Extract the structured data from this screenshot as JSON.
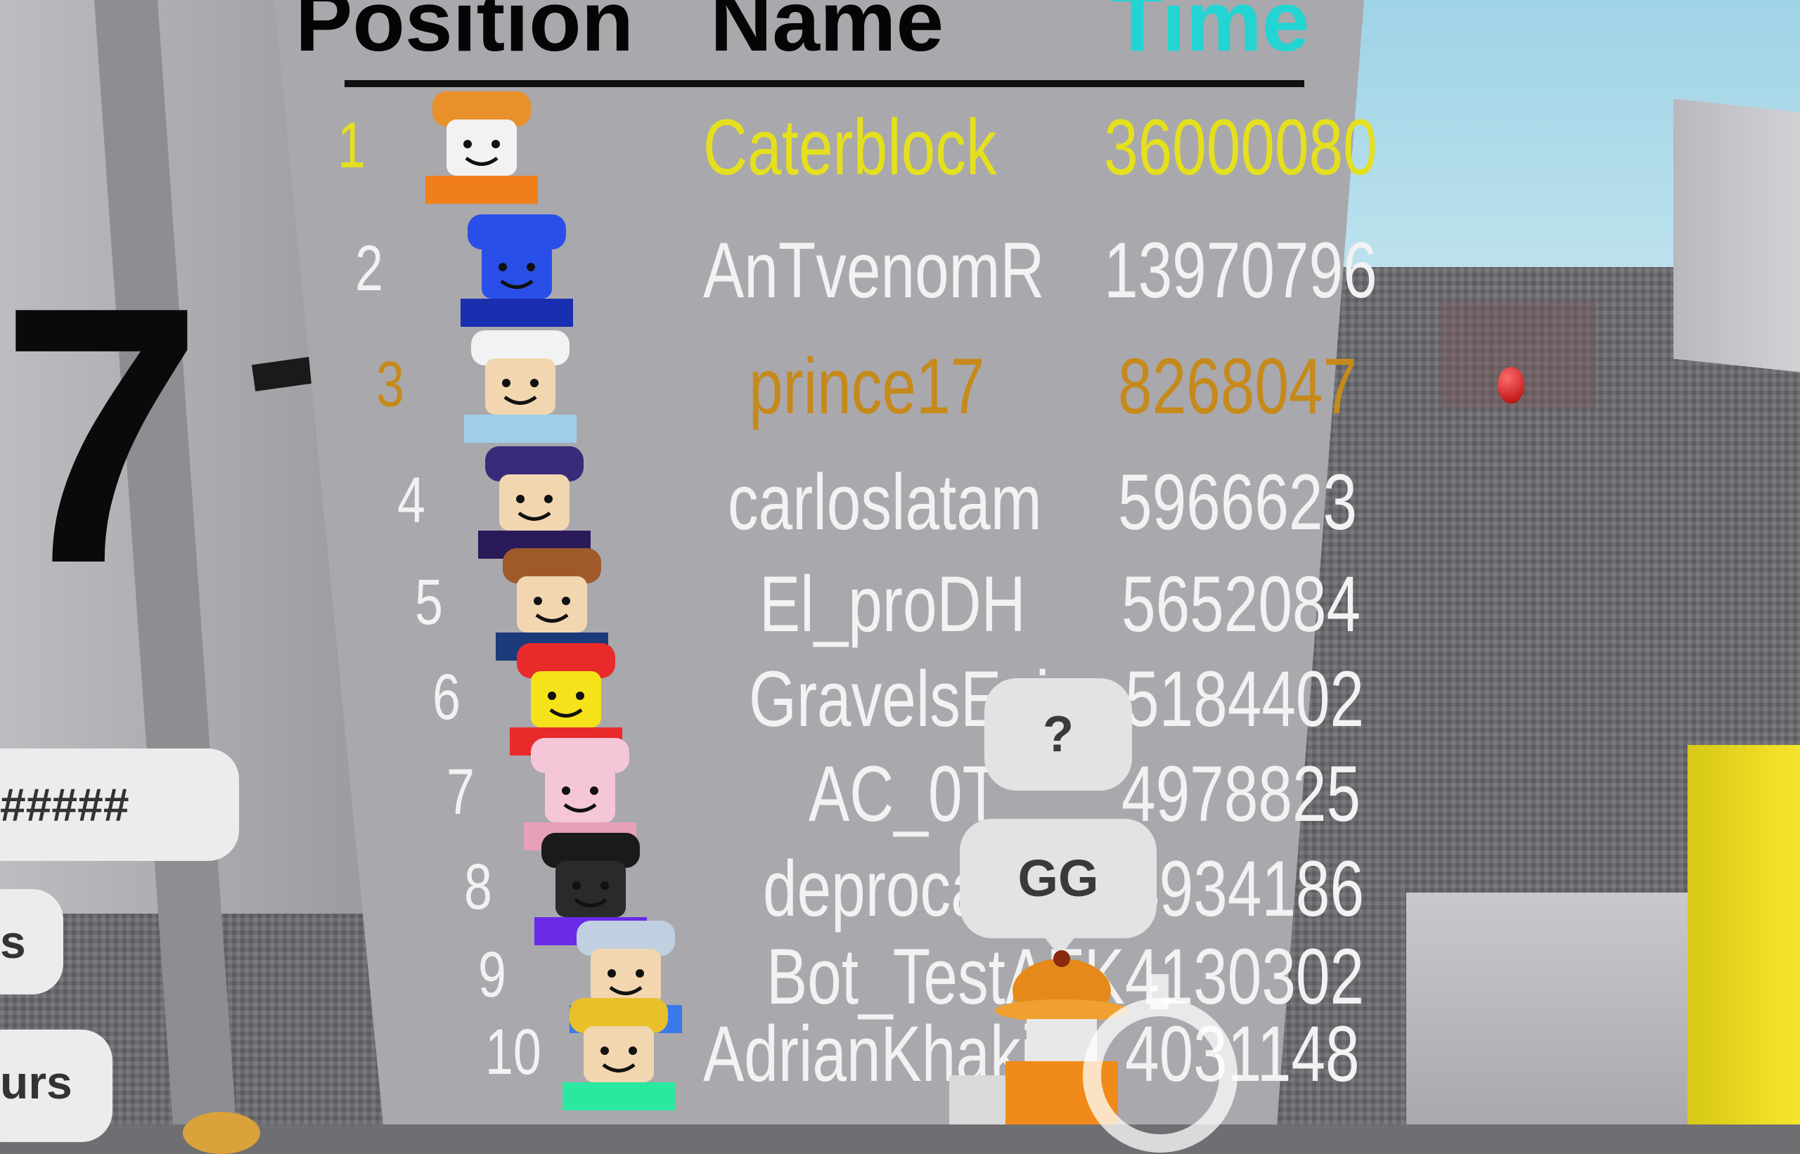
{
  "scene": {
    "sign_number": "7",
    "side_buttons": [
      "#####",
      "s",
      "urs"
    ]
  },
  "leaderboard": {
    "headers": {
      "position": "Position",
      "name": "Name",
      "time": "Time"
    },
    "colors": {
      "gold": "#e5e01d",
      "bronze": "#c58a1b",
      "default": "#f2f2f2",
      "time_header": "#22d4d2"
    },
    "rows": [
      {
        "position": "1",
        "name": "Caterblock",
        "time": "36000080",
        "rank_color": "gold",
        "avatar": "tiger-hat-avatar-icon"
      },
      {
        "position": "2",
        "name": "AnTvenomR",
        "time": "13970796",
        "rank_color": "default",
        "avatar": "blue-smiley-avatar-icon"
      },
      {
        "position": "3",
        "name": "prince17",
        "time": "8268047",
        "rank_color": "bronze",
        "avatar": "white-hat-avatar-icon"
      },
      {
        "position": "4",
        "name": "carloslatam",
        "time": "5966623",
        "rank_color": "default",
        "avatar": "wizard-hat-avatar-icon"
      },
      {
        "position": "5",
        "name": "El_proDH",
        "time": "5652084",
        "rank_color": "default",
        "avatar": "brown-hair-avatar-icon"
      },
      {
        "position": "6",
        "name": "GravelsEpic",
        "time": "5184402",
        "rank_color": "default",
        "avatar": "yellow-noob-avatar-icon"
      },
      {
        "position": "7",
        "name": "AC_0T",
        "time": "4978825",
        "rank_color": "default",
        "avatar": "bunny-ears-avatar-icon"
      },
      {
        "position": "8",
        "name": "deprocarter",
        "time": "4934186",
        "rank_color": "default",
        "avatar": "dark-rainbow-avatar-icon"
      },
      {
        "position": "9",
        "name": "Bot_TestAFK",
        "time": "4130302",
        "rank_color": "default",
        "avatar": "viking-avatar-icon"
      },
      {
        "position": "10",
        "name": "AdrianKhakiC",
        "time": "4031148",
        "rank_color": "default",
        "avatar": "colorful-avatar-icon"
      }
    ]
  },
  "chat_bubbles": {
    "question": "?",
    "message": "GG"
  },
  "player_avatar": "player-orange-hat-icon"
}
